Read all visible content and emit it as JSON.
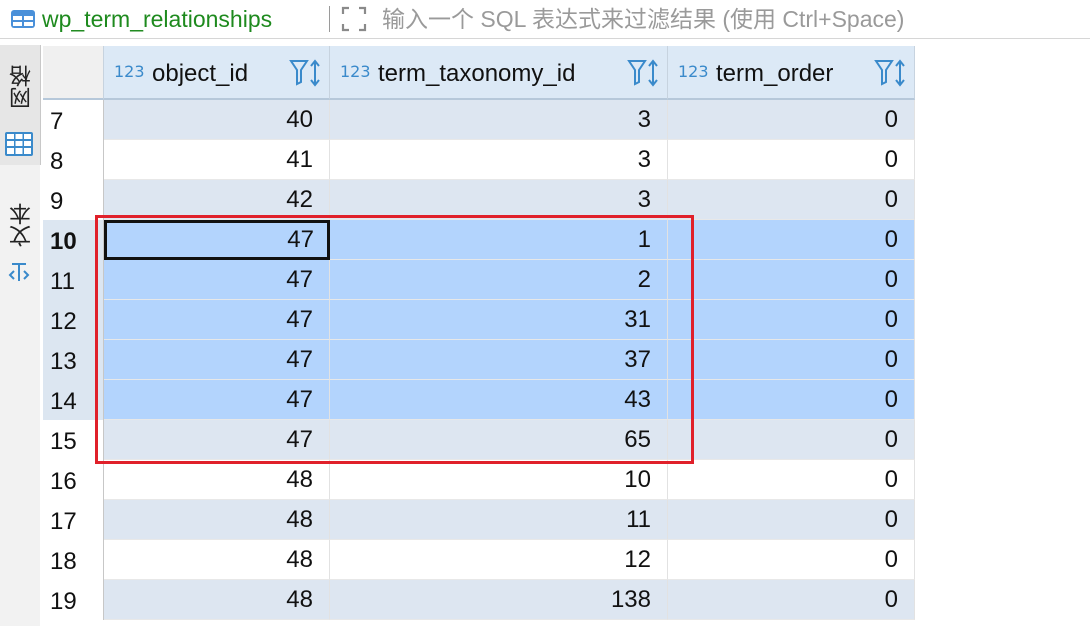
{
  "toolbar": {
    "table_name": "wp_term_relationships",
    "table_icon": "table-icon",
    "expand_icon": "expand-arrows-icon",
    "filter_placeholder": "输入一个 SQL 表达式来过滤结果 (使用 Ctrl+Space)"
  },
  "side_tabs": [
    {
      "label": "网格",
      "icon": "grid-icon"
    },
    {
      "label": "文本",
      "icon": "text-icon"
    }
  ],
  "columns": [
    {
      "name": "object_id",
      "type_icon": "123",
      "key": true
    },
    {
      "name": "term_taxonomy_id",
      "type_icon": "123",
      "key": true
    },
    {
      "name": "term_order",
      "type_icon": "123",
      "key": false
    }
  ],
  "rows": [
    {
      "num": "7",
      "object_id": "40",
      "term_taxonomy_id": "3",
      "term_order": "0"
    },
    {
      "num": "8",
      "object_id": "41",
      "term_taxonomy_id": "3",
      "term_order": "0"
    },
    {
      "num": "9",
      "object_id": "42",
      "term_taxonomy_id": "3",
      "term_order": "0"
    },
    {
      "num": "10",
      "object_id": "47",
      "term_taxonomy_id": "1",
      "term_order": "0"
    },
    {
      "num": "11",
      "object_id": "47",
      "term_taxonomy_id": "2",
      "term_order": "0"
    },
    {
      "num": "12",
      "object_id": "47",
      "term_taxonomy_id": "31",
      "term_order": "0"
    },
    {
      "num": "13",
      "object_id": "47",
      "term_taxonomy_id": "37",
      "term_order": "0"
    },
    {
      "num": "14",
      "object_id": "47",
      "term_taxonomy_id": "43",
      "term_order": "0"
    },
    {
      "num": "15",
      "object_id": "47",
      "term_taxonomy_id": "65",
      "term_order": "0"
    },
    {
      "num": "16",
      "object_id": "48",
      "term_taxonomy_id": "10",
      "term_order": "0"
    },
    {
      "num": "17",
      "object_id": "48",
      "term_taxonomy_id": "11",
      "term_order": "0"
    },
    {
      "num": "18",
      "object_id": "48",
      "term_taxonomy_id": "12",
      "term_order": "0"
    },
    {
      "num": "19",
      "object_id": "48",
      "term_taxonomy_id": "138",
      "term_order": "0"
    }
  ],
  "selected_rows": [
    "10",
    "11",
    "12",
    "13",
    "14"
  ],
  "focused_row": "10",
  "colors": {
    "table_name": "#1e8a1e",
    "header_bg": "#dce9f6",
    "alt_row_bg": "#dde6f1",
    "selected_row_bg": "#b3d4fd",
    "highlight_box": "#e0202a",
    "type_icon": "#3a8acb"
  }
}
